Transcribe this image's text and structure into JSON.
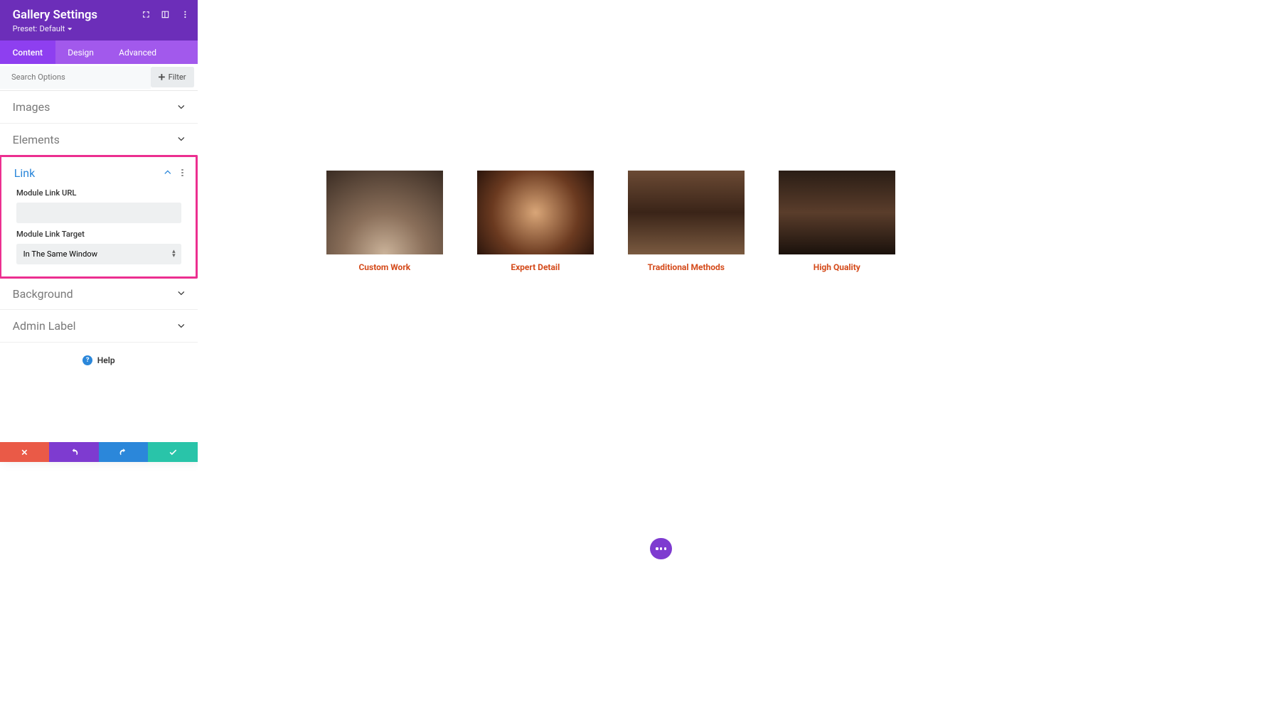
{
  "header": {
    "title": "Gallery Settings",
    "preset_prefix": "Preset:",
    "preset_value": "Default"
  },
  "tabs": {
    "content": "Content",
    "design": "Design",
    "advanced": "Advanced"
  },
  "search": {
    "placeholder": "Search Options",
    "filter_label": "Filter"
  },
  "sections": {
    "images": "Images",
    "elements": "Elements",
    "link": "Link",
    "background": "Background",
    "admin_label": "Admin Label"
  },
  "link_section": {
    "url_label": "Module Link URL",
    "url_value": "",
    "target_label": "Module Link Target",
    "target_value": "In The Same Window"
  },
  "help": {
    "label": "Help"
  },
  "gallery": {
    "items": [
      {
        "caption": "Custom Work"
      },
      {
        "caption": "Expert Detail"
      },
      {
        "caption": "Traditional Methods"
      },
      {
        "caption": "High Quality"
      }
    ]
  }
}
